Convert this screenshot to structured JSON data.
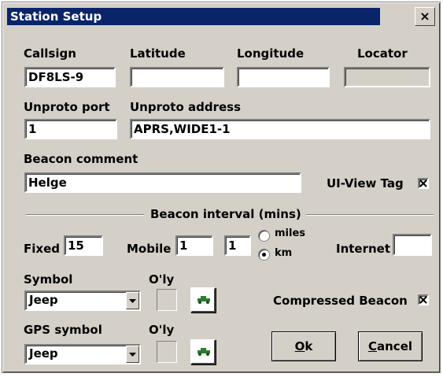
{
  "window": {
    "title": "Station Setup",
    "close_glyph": "×"
  },
  "station": {
    "callsign_label": "Callsign",
    "callsign_value": "DF8LS-9",
    "latitude_label": "Latitude",
    "latitude_value": "",
    "longitude_label": "Longitude",
    "longitude_value": "",
    "locator_label": "Locator",
    "locator_value": ""
  },
  "unproto": {
    "port_label": "Unproto port",
    "port_value": "1",
    "address_label": "Unproto address",
    "address_value": "APRS,WIDE1-1"
  },
  "beacon": {
    "comment_label": "Beacon comment",
    "comment_value": "Helge",
    "uiview_tag_label": "UI-View Tag",
    "uiview_tag_checked": true
  },
  "interval": {
    "group_label": "Beacon interval (mins)",
    "fixed_label": "Fixed",
    "fixed_value": "15",
    "mobile_label": "Mobile",
    "mobile_value": "1",
    "distance_value": "1",
    "unit_options": [
      "miles",
      "km"
    ],
    "unit_selected": "km",
    "internet_label": "Internet",
    "internet_value": ""
  },
  "symbol": {
    "label": "Symbol",
    "overlay_label": "O'ly",
    "value": "Jeep",
    "icon": "jeep-icon"
  },
  "gps_symbol": {
    "label": "GPS symbol",
    "overlay_label": "O'ly",
    "value": "Jeep",
    "icon": "jeep-icon"
  },
  "compressed": {
    "label": "Compressed Beacon",
    "checked": true
  },
  "buttons": {
    "ok_mnemonic": "O",
    "ok_rest": "k",
    "cancel_mnemonic": "C",
    "cancel_rest": "ancel"
  },
  "colors": {
    "titlebar": "#0a246a",
    "face": "#d4d0c8",
    "jeep": "#2e7d32"
  }
}
